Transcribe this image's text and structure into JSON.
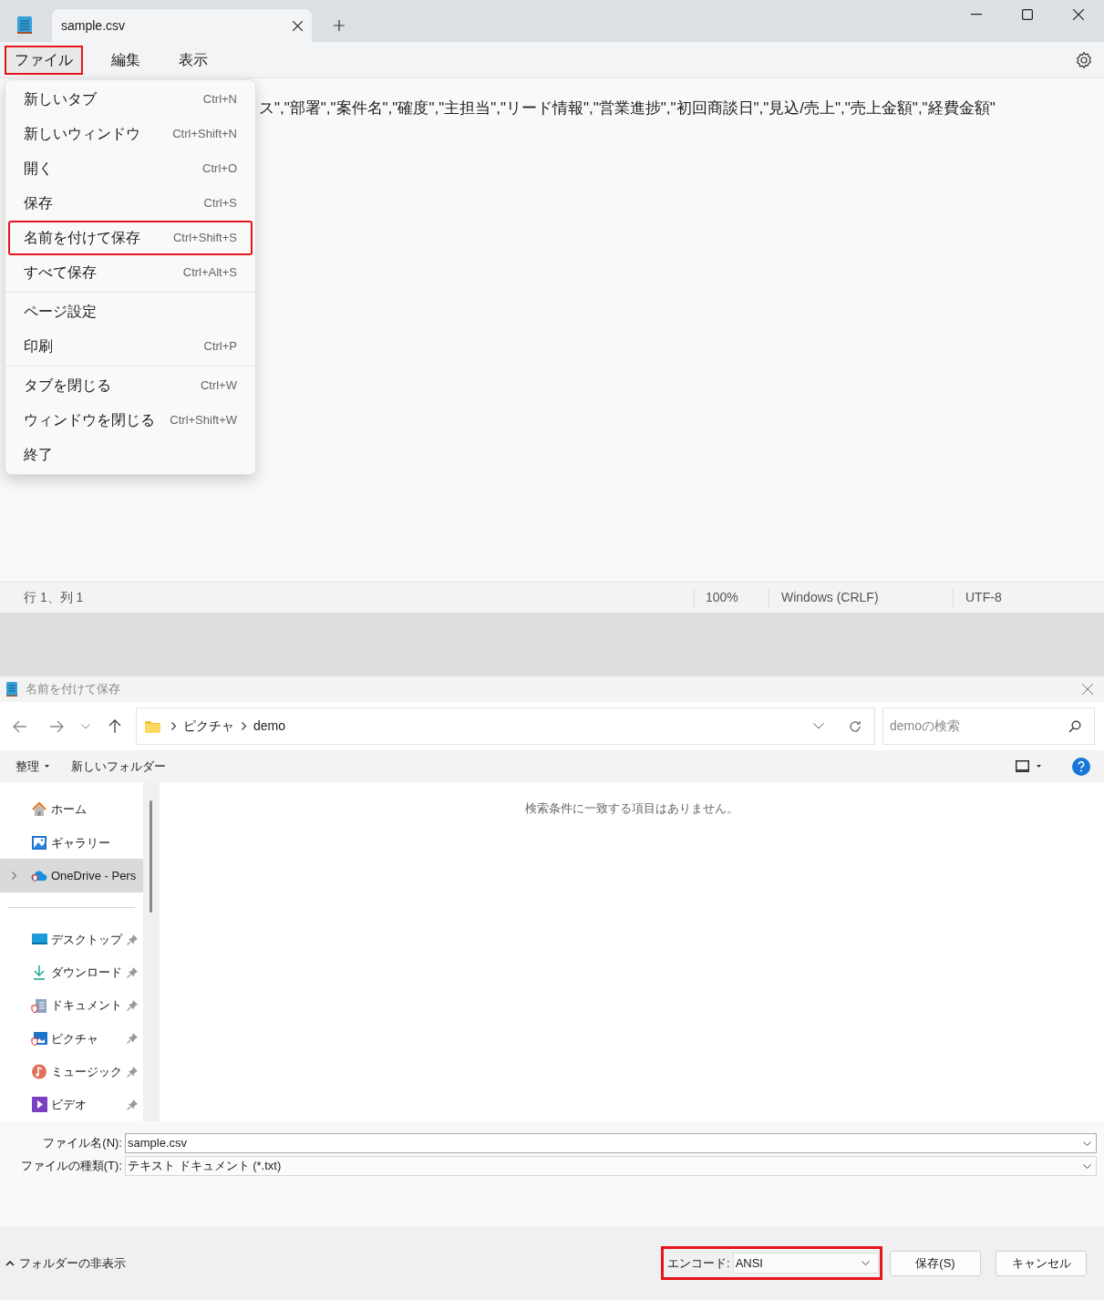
{
  "app": {
    "tabs": [
      {
        "title": "sample.csv",
        "selected": true
      }
    ],
    "menu_bar": [
      {
        "label": "ファイル",
        "highlighted": true,
        "open": true
      },
      {
        "label": "編集",
        "highlighted": false,
        "open": false
      },
      {
        "label": "表示",
        "highlighted": false,
        "open": false
      }
    ],
    "file_menu": {
      "groups": [
        [
          {
            "label": "新しいタブ",
            "shortcut": "Ctrl+N",
            "highlighted": false
          },
          {
            "label": "新しいウィンドウ",
            "shortcut": "Ctrl+Shift+N",
            "highlighted": false
          },
          {
            "label": "開く",
            "shortcut": "Ctrl+O",
            "highlighted": false
          },
          {
            "label": "保存",
            "shortcut": "Ctrl+S",
            "highlighted": false
          },
          {
            "label": "名前を付けて保存",
            "shortcut": "Ctrl+Shift+S",
            "highlighted": true
          },
          {
            "label": "すべて保存",
            "shortcut": "Ctrl+Alt+S",
            "highlighted": false
          }
        ],
        [
          {
            "label": "ページ設定",
            "highlighted": false
          },
          {
            "label": "印刷",
            "shortcut": "Ctrl+P",
            "highlighted": false
          }
        ],
        [
          {
            "label": "タブを閉じる",
            "shortcut": "Ctrl+W",
            "highlighted": false
          },
          {
            "label": "ウィンドウを閉じる",
            "shortcut": "Ctrl+Shift+W",
            "highlighted": false
          },
          {
            "label": "終了",
            "highlighted": false
          }
        ]
      ]
    },
    "editor": {
      "text": "ス\",\"部署\",\"案件名\",\"確度\",\"主担当\",\"リード情報\",\"営業進捗\",\"初回商談日\",\"見込/売上\",\"売上金額\",\"経費金額\""
    },
    "status_bar": {
      "position": "行 1、列 1",
      "zoom": "100%",
      "line_ending": "Windows (CRLF)",
      "encoding": "UTF-8"
    }
  },
  "dialog": {
    "title": "名前を付けて保存",
    "breadcrumb": [
      "ピクチャ",
      "demo"
    ],
    "search": {
      "placeholder": "demoの検索"
    },
    "toolbar": [
      {
        "label": "整理",
        "dropdown": true
      },
      {
        "label": "新しいフォルダー",
        "dropdown": false
      }
    ],
    "sidebar": {
      "groups": [
        [
          {
            "label": "ホーム",
            "kind": "home",
            "selected": false,
            "expandable": false,
            "pinned": false
          },
          {
            "label": "ギャラリー",
            "kind": "gallery",
            "selected": false,
            "expandable": false,
            "pinned": false
          },
          {
            "label": "OneDrive - Pers",
            "kind": "cloud",
            "selected": true,
            "expandable": true,
            "pinned": false
          }
        ],
        [
          {
            "label": "デスクトップ",
            "kind": "desktop",
            "selected": false,
            "expandable": false,
            "pinned": true
          },
          {
            "label": "ダウンロード",
            "kind": "download",
            "selected": false,
            "expandable": false,
            "pinned": true
          },
          {
            "label": "ドキュメント",
            "kind": "document",
            "selected": false,
            "expandable": false,
            "pinned": true
          },
          {
            "label": "ピクチャ",
            "kind": "pictures",
            "selected": false,
            "expandable": false,
            "pinned": true
          },
          {
            "label": "ミュージック",
            "kind": "music",
            "selected": false,
            "expandable": false,
            "pinned": true
          },
          {
            "label": "ビデオ",
            "kind": "video",
            "selected": false,
            "expandable": false,
            "pinned": true
          }
        ]
      ]
    },
    "empty_message": "検索条件に一致する項目はありません。",
    "file_name": {
      "label": "ファイル名(N):",
      "value": "sample.csv"
    },
    "file_type": {
      "label": "ファイルの種類(T):",
      "value": "テキスト ドキュメント (*.txt)"
    },
    "hide_folders": "フォルダーの非表示",
    "encoding": {
      "label": "エンコード:",
      "value": "ANSI",
      "highlighted": true
    },
    "buttons": [
      "保存(S)",
      "キャンセル"
    ]
  }
}
